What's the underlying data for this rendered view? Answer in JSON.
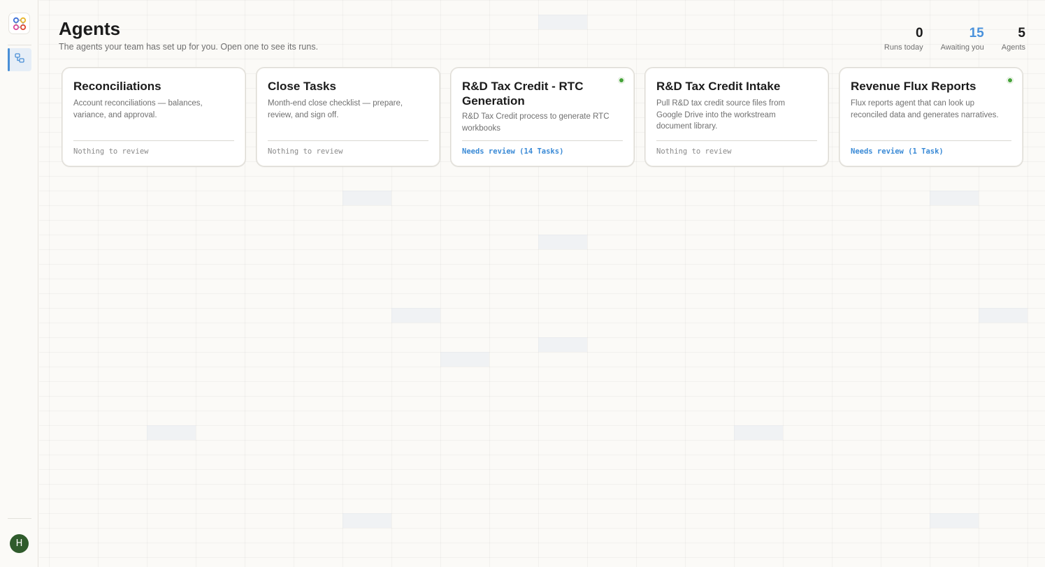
{
  "sidebar": {
    "logo_icon": "app-logo-icon",
    "nav": [
      {
        "id": "agents",
        "icon": "agents-icon",
        "active": true
      }
    ],
    "avatar_initial": "H"
  },
  "header": {
    "title": "Agents",
    "subtitle": "The agents your team has set up for you. Open one to see its runs."
  },
  "stats": [
    {
      "value": "0",
      "label": "Runs today"
    },
    {
      "value": "15",
      "label": "Awaiting you",
      "accent": "#4a92dc"
    },
    {
      "value": "5",
      "label": "Agents"
    }
  ],
  "agents": [
    {
      "title": "Reconciliations",
      "description": "Account reconciliations — balances, variance, and approval.",
      "status": "Nothing to review",
      "needs_review": false,
      "active": false
    },
    {
      "title": "Close Tasks",
      "description": "Month-end close checklist — prepare, review, and sign off.",
      "status": "Nothing to review",
      "needs_review": false,
      "active": false
    },
    {
      "title": "R&D Tax Credit - RTC Generation",
      "description": "R&D Tax Credit process to generate RTC workbooks",
      "status": "Needs review (14 Tasks)",
      "needs_review": true,
      "active": true
    },
    {
      "title": "R&D Tax Credit Intake",
      "description": "Pull R&D tax credit source files from Google Drive into the workstream document library.",
      "status": "Nothing to review",
      "needs_review": false,
      "active": false
    },
    {
      "title": "Revenue Flux Reports",
      "description": "Flux reports agent that can look up reconciled data and generates narratives.",
      "status": "Needs review (1 Task)",
      "needs_review": true,
      "active": true
    }
  ],
  "colors": {
    "accent": "#4a92dc",
    "active_dot": "#46a33a",
    "avatar_bg": "#2f5b2c"
  }
}
